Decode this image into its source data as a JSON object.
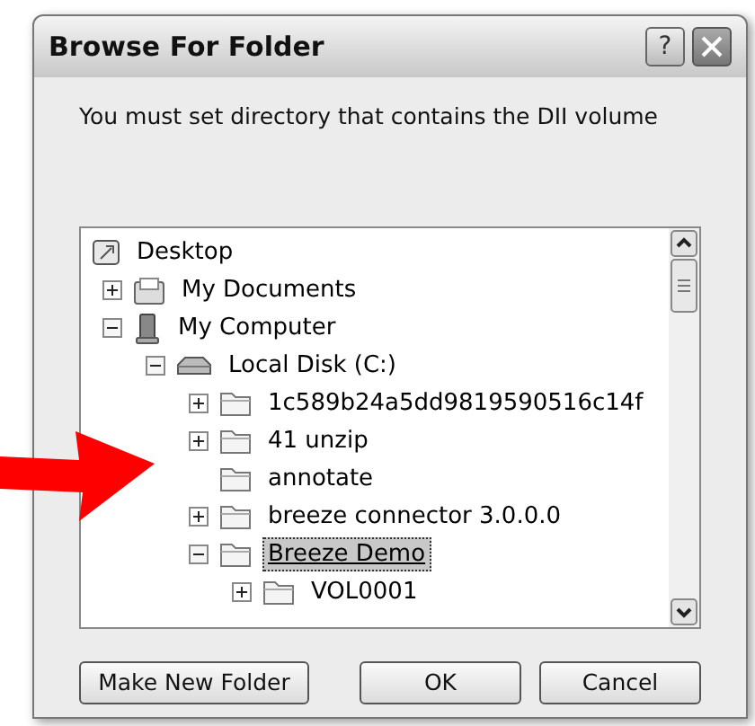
{
  "window": {
    "title": "Browse For Folder",
    "help_label": "?"
  },
  "instruction": "You must set directory that contains the DII volume",
  "tree": [
    {
      "label": "Desktop",
      "kind": "desktop",
      "selected": false,
      "children": [
        {
          "label": "My Documents",
          "kind": "documents",
          "expanded": false,
          "selected": false
        },
        {
          "label": "My Computer",
          "kind": "computer",
          "expanded": true,
          "selected": false,
          "children": [
            {
              "label": "Local Disk (C:)",
              "kind": "disk",
              "expanded": true,
              "selected": false,
              "children": [
                {
                  "label": "1c589b24a5dd9819590516c14f",
                  "kind": "folder",
                  "expanded": false,
                  "selected": false
                },
                {
                  "label": "41 unzip",
                  "kind": "folder",
                  "expanded": false,
                  "selected": false
                },
                {
                  "label": "annotate",
                  "kind": "folder",
                  "selected": false
                },
                {
                  "label": "breeze connector 3.0.0.0",
                  "kind": "folder",
                  "expanded": false,
                  "selected": false
                },
                {
                  "label": "Breeze Demo",
                  "kind": "folder",
                  "expanded": true,
                  "selected": true,
                  "children": [
                    {
                      "label": "VOL0001",
                      "kind": "folder",
                      "expanded": false,
                      "selected": false
                    }
                  ]
                }
              ]
            }
          ]
        }
      ]
    }
  ],
  "buttons": [
    {
      "label": "Make New Folder",
      "kind": "left"
    },
    {
      "label": "OK",
      "kind": "right"
    },
    {
      "label": "Cancel",
      "kind": "right"
    }
  ]
}
